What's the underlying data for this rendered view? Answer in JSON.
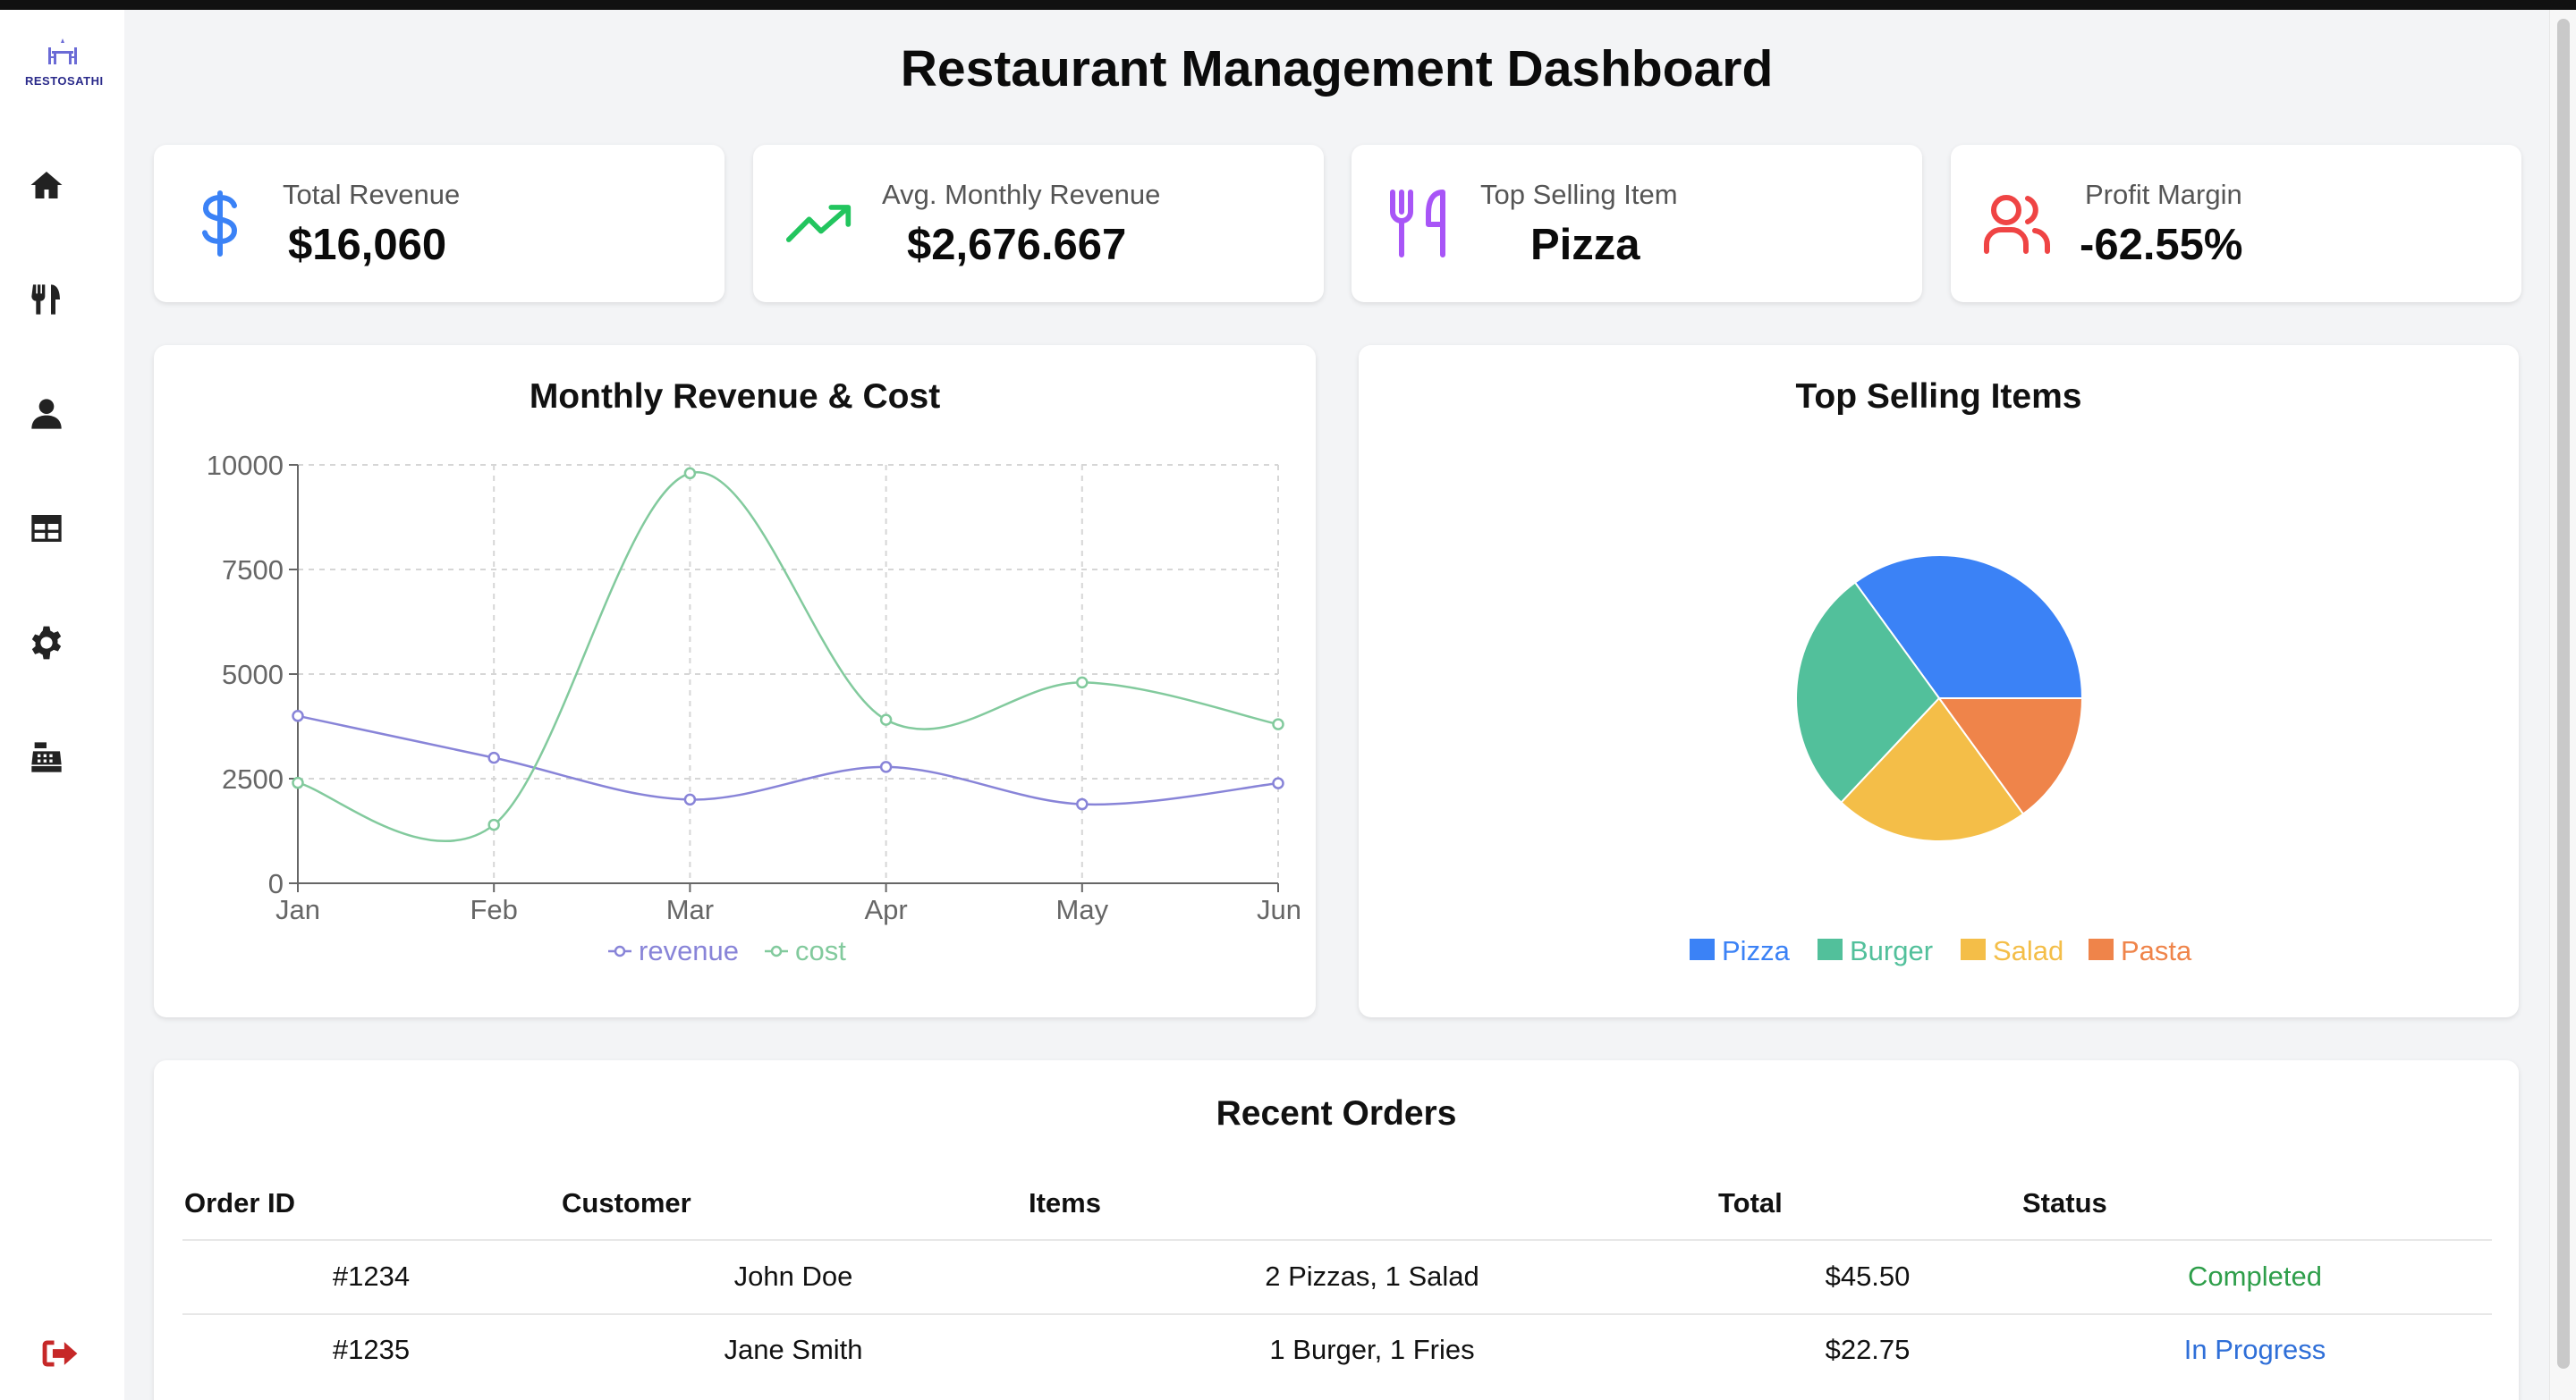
{
  "app": {
    "logo_text": "RESTOSATHI",
    "title": "Restaurant Management Dashboard"
  },
  "sidebar": {
    "items": [
      {
        "icon": "home-icon"
      },
      {
        "icon": "utensils-icon"
      },
      {
        "icon": "user-icon"
      },
      {
        "icon": "table-icon"
      },
      {
        "icon": "gear-icon"
      },
      {
        "icon": "cash-register-icon"
      }
    ],
    "logout_icon": "logout-icon"
  },
  "stats": [
    {
      "label": "Total Revenue",
      "value": "$16,060",
      "icon": "dollar-icon",
      "color": "#3b82f6"
    },
    {
      "label": "Avg. Monthly Revenue",
      "value": "$2,676.667",
      "icon": "trending-up-icon",
      "color": "#22c55e"
    },
    {
      "label": "Top Selling Item",
      "value": "Pizza",
      "icon": "utensils-icon",
      "color": "#a855f7"
    },
    {
      "label": "Profit Margin",
      "value": "-62.55%",
      "icon": "users-icon",
      "color": "#ef4444"
    }
  ],
  "charts": {
    "line_title": "Monthly Revenue & Cost",
    "pie_title": "Top Selling Items"
  },
  "chart_data": [
    {
      "type": "line",
      "title": "Monthly Revenue & Cost",
      "categories": [
        "Jan",
        "Feb",
        "Mar",
        "Apr",
        "May",
        "Jun"
      ],
      "ylim": [
        0,
        10000
      ],
      "yticks": [
        "0",
        "2500",
        "5000",
        "7500",
        "10000"
      ],
      "grid": true,
      "legend": "bottom",
      "series": [
        {
          "name": "revenue",
          "color": "#8884d8",
          "values": [
            4000,
            3000,
            2000,
            2780,
            1890,
            2390
          ]
        },
        {
          "name": "cost",
          "color": "#82ca9d",
          "values": [
            2400,
            1398,
            9800,
            3908,
            4800,
            3800
          ]
        }
      ]
    },
    {
      "type": "pie",
      "title": "Top Selling Items",
      "legend": "bottom",
      "slices": [
        {
          "name": "Pizza",
          "value": 35,
          "color": "#3b82f6"
        },
        {
          "name": "Burger",
          "value": 28,
          "color": "#52c09b"
        },
        {
          "name": "Salad",
          "value": 22,
          "color": "#f4be48"
        },
        {
          "name": "Pasta",
          "value": 15,
          "color": "#ef844a"
        }
      ]
    }
  ],
  "orders": {
    "title": "Recent Orders",
    "columns": [
      "Order ID",
      "Customer",
      "Items",
      "Total",
      "Status"
    ],
    "rows": [
      {
        "id": "#1234",
        "customer": "John Doe",
        "items": "2 Pizzas, 1 Salad",
        "total": "$45.50",
        "status": "Completed",
        "status_color": "#2e9e4a"
      },
      {
        "id": "#1235",
        "customer": "Jane Smith",
        "items": "1 Burger, 1 Fries",
        "total": "$22.75",
        "status": "In Progress",
        "status_color": "#2f6fd8"
      }
    ]
  }
}
